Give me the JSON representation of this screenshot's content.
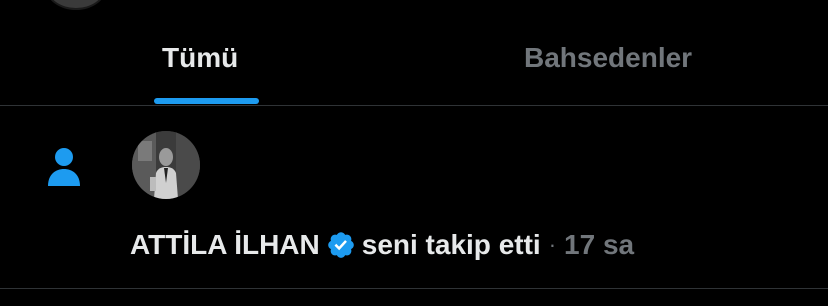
{
  "tabs": [
    {
      "label": "Tümü",
      "active": true
    },
    {
      "label": "Bahsedenler",
      "active": false
    }
  ],
  "colors": {
    "background": "#000000",
    "accent": "#1d9bf0",
    "text_primary": "#e7e9ea",
    "text_secondary": "#71767b",
    "divider": "#2f3336"
  },
  "notification": {
    "type_icon": "follow-person-icon",
    "user_name": "ATTİLA İLHAN",
    "verified_icon": "verified-badge-icon",
    "action_text": "seni takip etti",
    "separator": "·",
    "time": "17 sa"
  }
}
